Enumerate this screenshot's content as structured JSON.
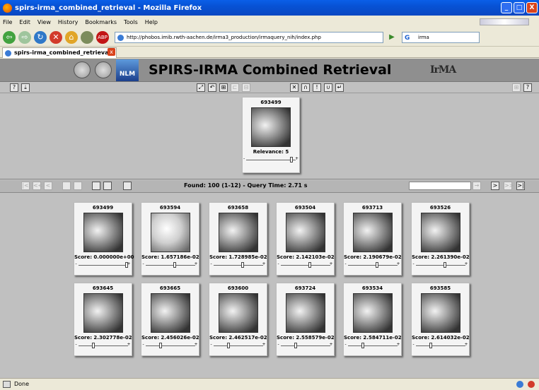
{
  "window": {
    "title": "spirs-irma_combined_retrieval - Mozilla Firefox",
    "buttons": [
      "_",
      "□",
      "X"
    ]
  },
  "menu": [
    "File",
    "Edit",
    "View",
    "History",
    "Bookmarks",
    "Tools",
    "Help"
  ],
  "navbar": {
    "url": "http://phobos.imib.rwth-aachen.de/irma3_production/irmaquery_nih/index.php",
    "search_value": "irma",
    "back": "⇦",
    "forward": "⇨",
    "reload": "↻",
    "stop": "✕",
    "home": "⌂",
    "adblock": "ABP",
    "go": "▶"
  },
  "tab": {
    "label": "spirs-irma_combined_retrieval",
    "close": "x"
  },
  "banner": {
    "title": "SPIRS-IRMA Combined Retrieval",
    "nlm": "NLM",
    "irma_logo": "IrMA"
  },
  "toolbar1": {
    "icons": [
      "?",
      "⤓",
      "⤢",
      "↶",
      "⊞",
      "⊏",
      "⊟",
      "✕",
      "∩",
      "!",
      "∪",
      "↵",
      "⊞",
      "?"
    ]
  },
  "query": {
    "id": "693499",
    "label": "Relevance: 5",
    "relevance": 5,
    "minus": "-",
    "plus": "+"
  },
  "navigation": {
    "found_text": "Found: 100 (1-12) - Query Time: 2.71 s",
    "icons": [
      "|<",
      "<<",
      "<",
      "nav-disabled-1",
      "nav-disabled-2",
      "grid",
      "list",
      "image",
      ">",
      ">>",
      ">|",
      "→"
    ],
    "jump_value": ""
  },
  "results": [
    {
      "id": "693499",
      "score": "Score: 0.000000e+00",
      "slider": 1.0
    },
    {
      "id": "693594",
      "score": "Score: 1.657186e-02",
      "slider": 0.6
    },
    {
      "id": "693658",
      "score": "Score: 1.728985e-02",
      "slider": 0.6
    },
    {
      "id": "693504",
      "score": "Score: 2.142103e-02",
      "slider": 0.6
    },
    {
      "id": "693713",
      "score": "Score: 2.190679e-02",
      "slider": 0.6
    },
    {
      "id": "693526",
      "score": "Score: 2.261390e-02",
      "slider": 0.6
    },
    {
      "id": "693645",
      "score": "Score: 2.302778e-02",
      "slider": 0.3
    },
    {
      "id": "693665",
      "score": "Score: 2.456026e-02",
      "slider": 0.3
    },
    {
      "id": "693600",
      "score": "Score: 2.462517e-02",
      "slider": 0.3
    },
    {
      "id": "693724",
      "score": "Score: 2.558579e-02",
      "slider": 0.3
    },
    {
      "id": "693534",
      "score": "Score: 2.584711e-02",
      "slider": 0.3
    },
    {
      "id": "693585",
      "score": "Score: 2.614032e-02",
      "slider": 0.3
    }
  ],
  "status": {
    "text": "Done"
  }
}
